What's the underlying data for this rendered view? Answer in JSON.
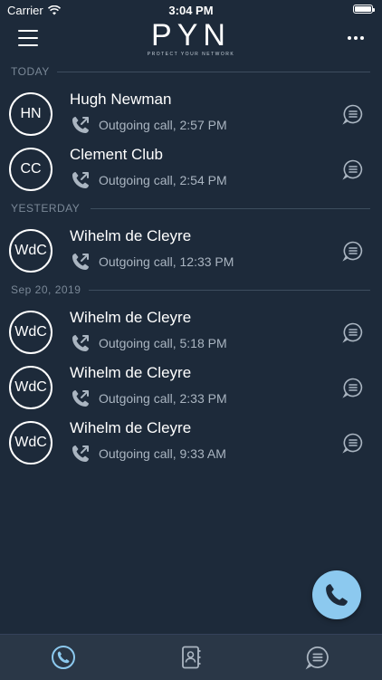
{
  "status_bar": {
    "carrier": "Carrier",
    "time": "3:04 PM"
  },
  "header": {
    "logo": "PYN",
    "tagline": "PROTECT YOUR NETWORK"
  },
  "sections": [
    {
      "label": "TODAY"
    },
    {
      "label": "YESTERDAY"
    },
    {
      "label": "Sep 20, 2019"
    }
  ],
  "calls": [
    {
      "initials": "HN",
      "name": "Hugh Newman",
      "detail": "Outgoing call, 2:57 PM"
    },
    {
      "initials": "CC",
      "name": "Clement Club",
      "detail": "Outgoing call, 2:54 PM"
    },
    {
      "initials": "WdC",
      "name": "Wihelm de Cleyre",
      "detail": "Outgoing call, 12:33 PM"
    },
    {
      "initials": "WdC",
      "name": "Wihelm de Cleyre",
      "detail": "Outgoing call, 5:18 PM"
    },
    {
      "initials": "WdC",
      "name": "Wihelm de Cleyre",
      "detail": "Outgoing call, 2:33 PM"
    },
    {
      "initials": "WdC",
      "name": "Wihelm de Cleyre",
      "detail": "Outgoing call, 9:33 AM"
    }
  ],
  "tabs": [
    {
      "icon": "phone-icon",
      "active": true
    },
    {
      "icon": "contacts-icon",
      "active": false
    },
    {
      "icon": "messages-icon",
      "active": false
    }
  ],
  "colors": {
    "background": "#1d2a3a",
    "tab_bar": "#2a3747",
    "accent": "#8cc9ef",
    "secondary_text": "#aab5c1",
    "section_text": "#7a8897"
  }
}
